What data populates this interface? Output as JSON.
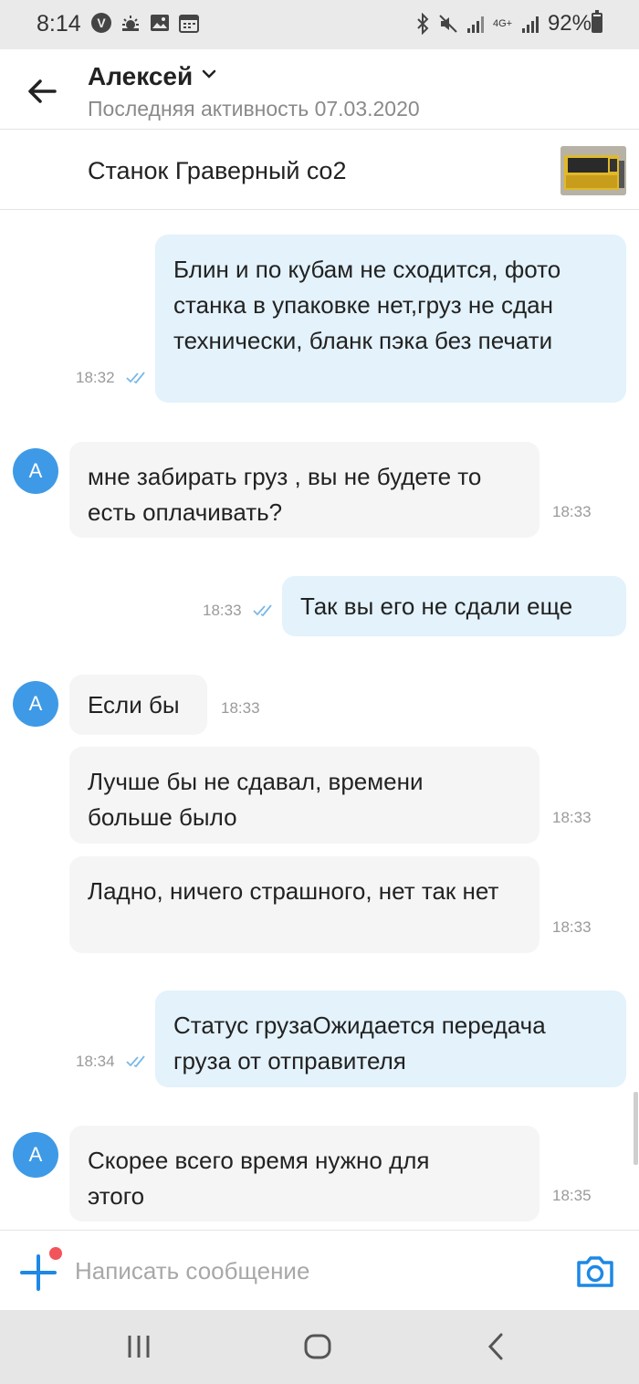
{
  "status_bar": {
    "time": "8:14",
    "battery": "92%",
    "network": "4G+"
  },
  "header": {
    "contact_name": "Алексей",
    "last_active": "Последняя активность 07.03.2020"
  },
  "product": {
    "title": "Станок Граверный co2"
  },
  "messages": [
    {
      "direction": "out",
      "text": "Блин и по кубам не сходится, фото станка в упаковке нет,груз не сдан технически, бланк пэка без печати",
      "time": "18:32"
    },
    {
      "direction": "in",
      "text": "мне забирать груз , вы не будете то есть оплачивать?",
      "time": "18:33",
      "avatar": "A"
    },
    {
      "direction": "out",
      "text": "Так вы его не сдали еще",
      "time": "18:33"
    },
    {
      "direction": "in",
      "text": "Если бы",
      "time": "18:33",
      "avatar": "A"
    },
    {
      "direction": "in",
      "text": "Лучше бы не сдавал, времени больше было",
      "time": "18:33"
    },
    {
      "direction": "in",
      "text": "Ладно, ничего страшного, нет так нет",
      "time": "18:33"
    },
    {
      "direction": "out",
      "text": "Статус грузаОжидается передача груза от отправителя",
      "time": "18:34"
    },
    {
      "direction": "in",
      "text": "Скорее всего время нужно для этого",
      "time": "18:35",
      "avatar": "A"
    }
  ],
  "composer": {
    "placeholder": "Написать сообщение"
  },
  "colors": {
    "accent": "#1e88e5",
    "outgoing_bubble": "#e3f2fb",
    "incoming_bubble": "#f5f5f5",
    "avatar": "#3e9ae6",
    "notification_dot": "#f2545b"
  }
}
